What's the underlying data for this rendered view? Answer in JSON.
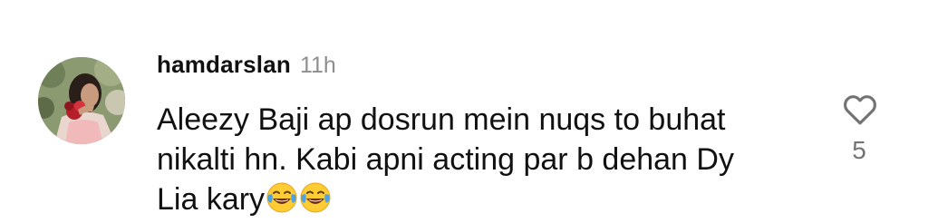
{
  "comment": {
    "username": "hamdarslan",
    "time_ago": "11h",
    "text": "Aleezy Baji ap dosrun mein nuqs to buhat nikalti hn. Kabi apni acting par b dehan Dy Lia kary",
    "emojis": [
      "face-with-tears-of-joy",
      "face-with-tears-of-joy"
    ],
    "like_icon": "heart-outline-icon",
    "like_count": "5"
  },
  "colors": {
    "text": "#111111",
    "timestamp": "#8e8e8e",
    "like_count": "#737373",
    "background": "#ffffff"
  }
}
